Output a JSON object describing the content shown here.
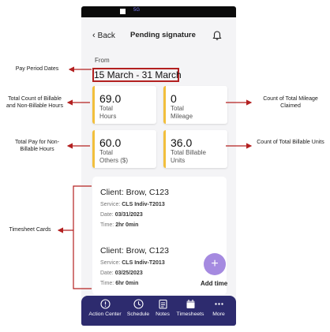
{
  "status_bar": {
    "indicator_text": "5G"
  },
  "header": {
    "back_label": "Back",
    "title": "Pending signature",
    "bell_icon": "bell-icon"
  },
  "period": {
    "from_label": "From",
    "dates": "15 March - 31 March"
  },
  "summary": {
    "total_hours": {
      "value": "69.0",
      "label": "Total\nHours"
    },
    "total_mileage": {
      "value": "0",
      "label": "Total\nMileage"
    },
    "total_others": {
      "value": "60.0",
      "label": "Total\nOthers ($)"
    },
    "total_billable_units": {
      "value": "36.0",
      "label": "Total Billable\nUnits"
    }
  },
  "timesheets": [
    {
      "client": "Client: Brow, C123",
      "service_label": "Service:",
      "service": "CLS Indiv-T2013",
      "date_label": "Date:",
      "date": "03/31/2023",
      "time_label": "Time:",
      "time": "2hr 0min"
    },
    {
      "client": "Client: Brow, C123",
      "service_label": "Service:",
      "service": "CLS Indiv-T2013",
      "date_label": "Date:",
      "date": "03/25/2023",
      "time_label": "Time:",
      "time": "6hr 0min"
    }
  ],
  "fab": {
    "icon": "plus-icon",
    "label": "Add time"
  },
  "nav": [
    {
      "label": "Action Center",
      "icon": "alert-circle-icon"
    },
    {
      "label": "Schedule",
      "icon": "clock-icon"
    },
    {
      "label": "Notes",
      "icon": "notes-icon"
    },
    {
      "label": "Timesheets",
      "icon": "calendar-icon"
    },
    {
      "label": "More",
      "icon": "more-dots-icon"
    }
  ],
  "annotations": {
    "pay_period": "Pay Period Dates",
    "billable_hours": "Total Count of Billable and Non-Billable Hours",
    "total_pay": "Total Pay for Non-Billable Hours",
    "timesheet_cards": "Timesheet Cards",
    "mileage": "Count of Total Mileage Claimed",
    "billable_units": "Count of Total Billable Units"
  },
  "colors": {
    "accent_purple": "#a58ae0",
    "nav_bg": "#2d2b6e",
    "card_border": "#f2bf3c",
    "annotation_red": "#b32020"
  }
}
